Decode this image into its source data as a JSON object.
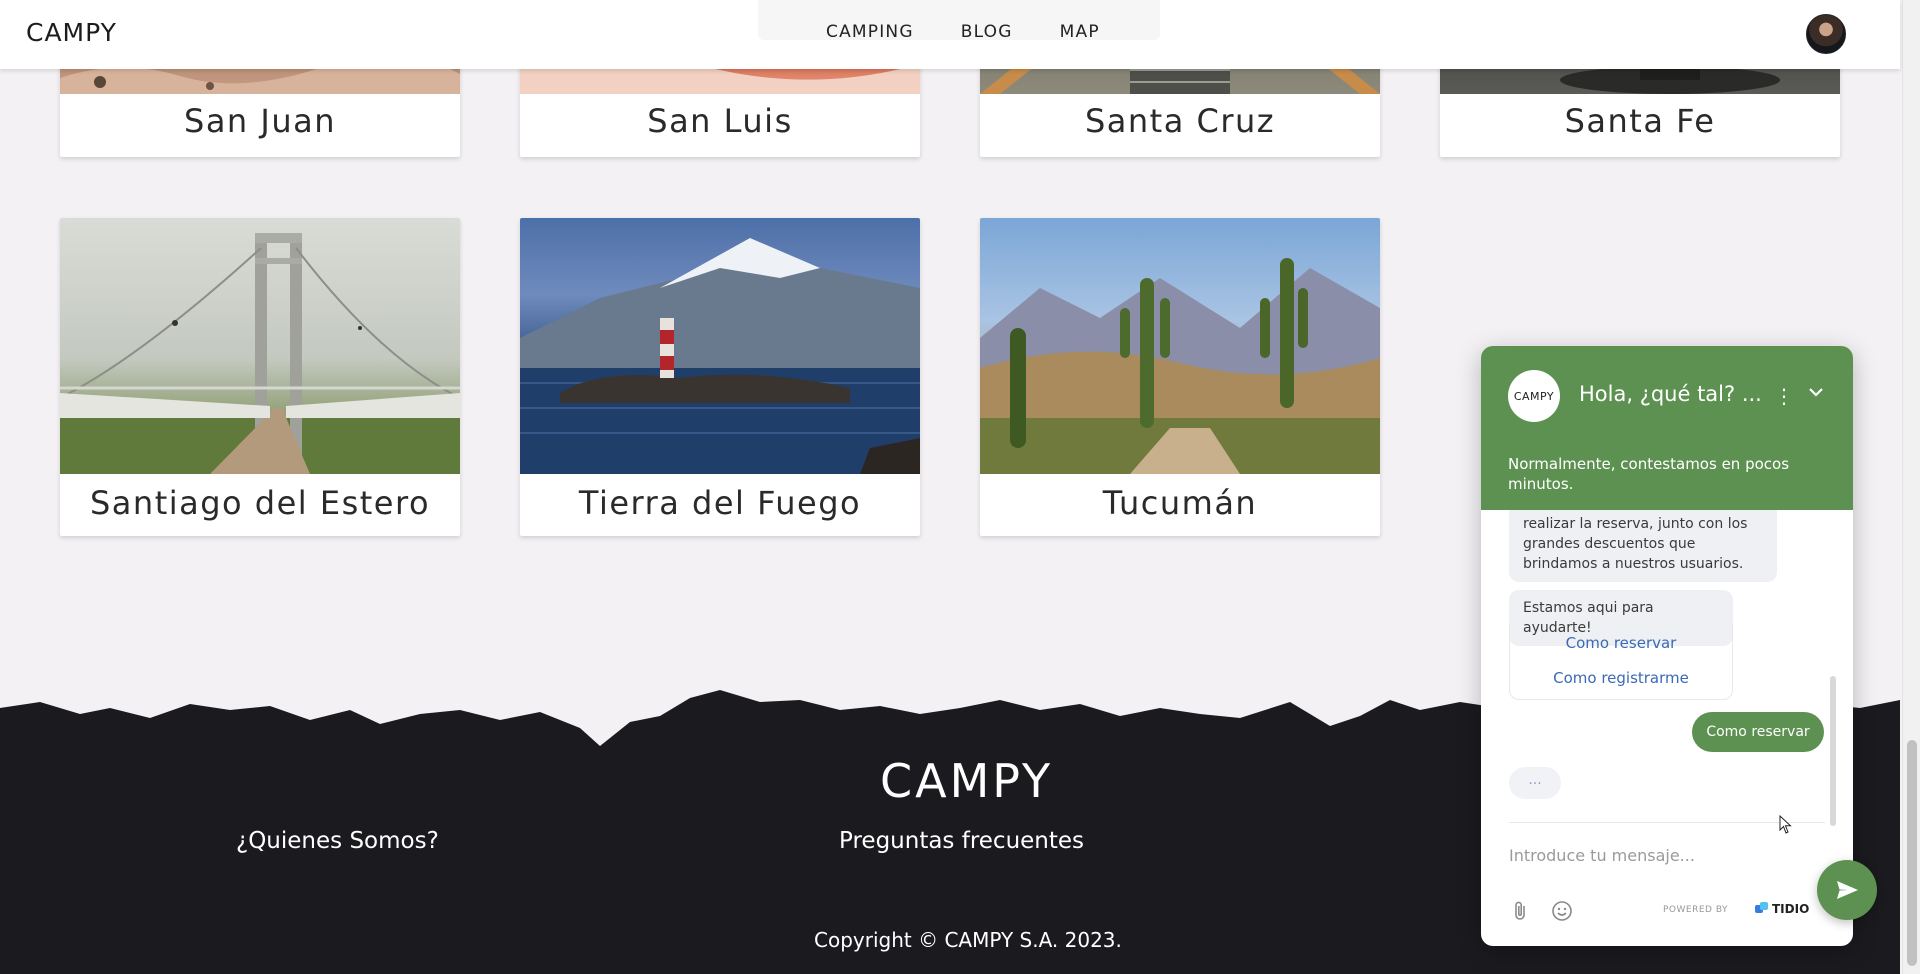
{
  "header": {
    "logo": "CAMPY",
    "nav": [
      "CAMPING",
      "BLOG",
      "MAP"
    ]
  },
  "cards": [
    {
      "label": "San Juan"
    },
    {
      "label": "San Luis"
    },
    {
      "label": "Santa Cruz"
    },
    {
      "label": "Santa Fe"
    },
    {
      "label": "Santiago del Estero"
    },
    {
      "label": "Tierra del Fuego"
    },
    {
      "label": "Tucumán"
    }
  ],
  "footer": {
    "logo": "CAMPY",
    "about": "¿Quienes Somos?",
    "faq": "Preguntas frecuentes",
    "copyright": "Copyright © CAMPY S.A. 2023."
  },
  "chat": {
    "avatar_text": "CAMPY",
    "title": "Hola, ¿qué tal? ...",
    "subtitle": "Normalmente, contestamos en pocos minutos.",
    "message_partial": "realizar la reserva, junto con los grandes descuentos que brindamos a nuestros usuarios.",
    "message_help": "Estamos aqui para ayudarte!",
    "quick_replies": [
      "Como reservar",
      "Como registrarme"
    ],
    "user_message": "Como reservar",
    "typing": "...",
    "input_placeholder": "Introduce tu mensaje...",
    "powered_by": "POWERED BY",
    "brand": "TIDIO",
    "brand_color": "#5d9151"
  }
}
